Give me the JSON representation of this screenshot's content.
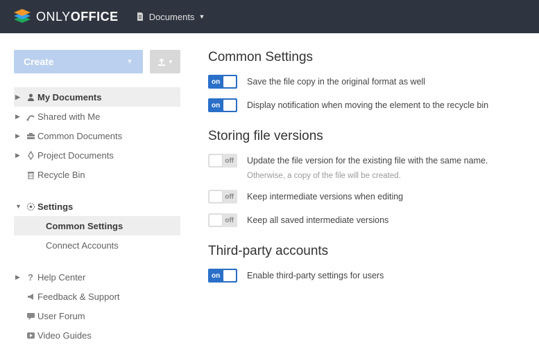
{
  "header": {
    "brand_light": "ONLY",
    "brand_bold": "OFFICE",
    "menu_label": "Documents"
  },
  "sidebar": {
    "create_label": "Create",
    "nav": [
      {
        "label": "My Documents"
      },
      {
        "label": "Shared with Me"
      },
      {
        "label": "Common Documents"
      },
      {
        "label": "Project Documents"
      },
      {
        "label": "Recycle Bin"
      }
    ],
    "settings_label": "Settings",
    "settings_children": [
      {
        "label": "Common Settings"
      },
      {
        "label": "Connect Accounts"
      }
    ],
    "help": [
      {
        "label": "Help Center"
      },
      {
        "label": "Feedback & Support"
      },
      {
        "label": "User Forum"
      },
      {
        "label": "Video Guides"
      }
    ]
  },
  "content": {
    "sec1_title": "Common Settings",
    "sec1_items": [
      {
        "state": "on",
        "label": "Save the file copy in the original format as well"
      },
      {
        "state": "on",
        "label": "Display notification when moving the element to the recycle bin"
      }
    ],
    "sec2_title": "Storing file versions",
    "sec2_items": [
      {
        "state": "off",
        "label": "Update the file version for the existing file with the same name."
      },
      {
        "state": "off",
        "label": "Keep intermediate versions when editing"
      },
      {
        "state": "off",
        "label": "Keep all saved intermediate versions"
      }
    ],
    "sec2_hint": "Otherwise, a copy of the file will be created.",
    "sec3_title": "Third-party accounts",
    "sec3_items": [
      {
        "state": "on",
        "label": "Enable third-party settings for users"
      }
    ],
    "toggle_on_text": "on",
    "toggle_off_text": "off"
  }
}
